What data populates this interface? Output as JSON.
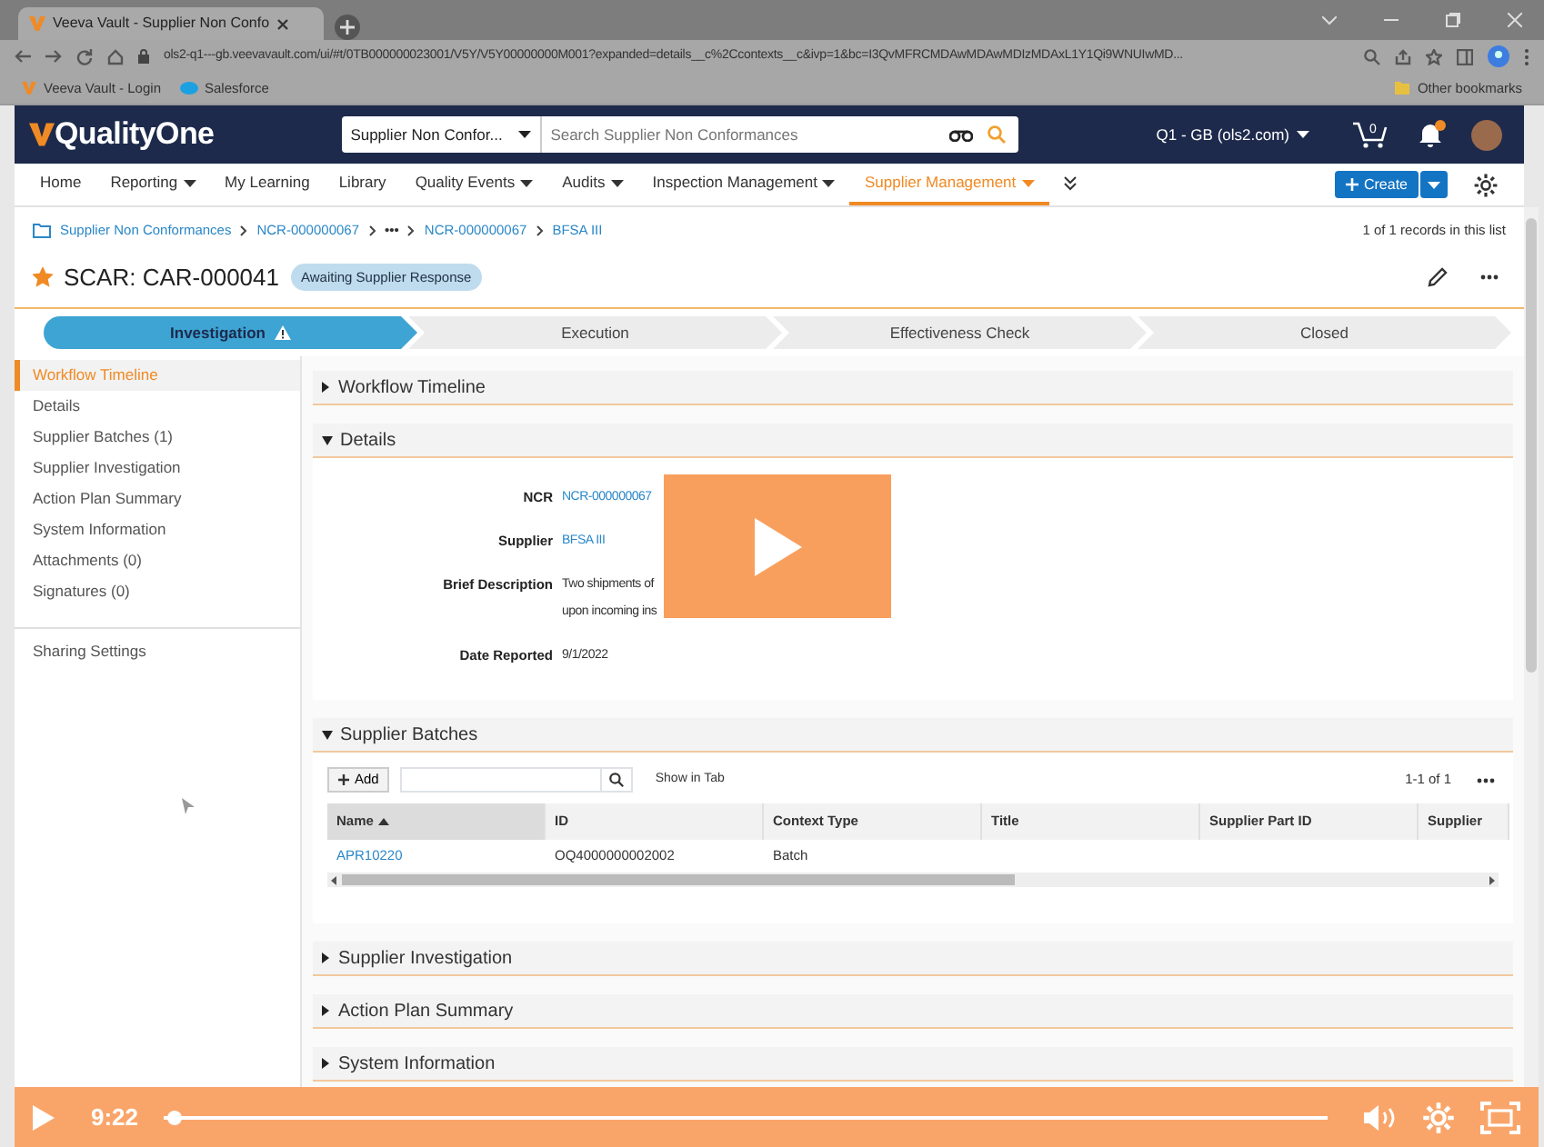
{
  "browser": {
    "tabs": [
      {
        "title": "Veeva Vault - Supplier Non Confo",
        "selected": true
      }
    ],
    "url": "ols2-q1---gb.veevavault.com/ui/#t/0TB000000023001/V5Y/V5Y00000000M001?expanded=details__c%2Ccontexts__c&ivp=1&bc=I3QvMFRCMDAwMDAwMDIzMDAxL1Y1Qi9WNUIwMD...",
    "bookmarks": [
      "Veeva Vault - Login",
      "Salesforce"
    ],
    "other_bookmarks": "Other bookmarks"
  },
  "app": {
    "logo": "QualityOne",
    "search_scope": "Supplier Non Confor...",
    "search_placeholder": "Search Supplier Non Conformances",
    "vault": "Q1 - GB (ols2.com)",
    "cart_count": "0",
    "has_notifications": true
  },
  "nav": [
    {
      "label": "Home",
      "dropdown": false,
      "selected": false
    },
    {
      "label": "Reporting",
      "dropdown": true,
      "selected": false
    },
    {
      "label": "My Learning",
      "dropdown": false,
      "selected": false
    },
    {
      "label": "Library",
      "dropdown": false,
      "selected": false
    },
    {
      "label": "Quality Events",
      "dropdown": true,
      "selected": false
    },
    {
      "label": "Audits",
      "dropdown": true,
      "selected": false
    },
    {
      "label": "Inspection Management",
      "dropdown": true,
      "selected": false
    },
    {
      "label": "Supplier Management",
      "dropdown": true,
      "selected": true
    }
  ],
  "create_button": "Create",
  "breadcrumb": [
    "Supplier Non Conformances",
    "NCR-000000067",
    "•••",
    "NCR-000000067",
    "BFSA III"
  ],
  "records": "1 of 1 records in this list",
  "record": {
    "title": "SCAR: CAR-000041",
    "favorite": true,
    "status": "Awaiting Supplier Response"
  },
  "stages": [
    {
      "label": "Investigation",
      "selected": true,
      "warning": true
    },
    {
      "label": "Execution",
      "selected": false,
      "warning": false
    },
    {
      "label": "Effectiveness Check",
      "selected": false,
      "warning": false
    },
    {
      "label": "Closed",
      "selected": false,
      "warning": false
    }
  ],
  "sidebar": {
    "items": [
      {
        "label": "Workflow Timeline",
        "selected": true
      },
      {
        "label": "Details",
        "selected": false
      },
      {
        "label": "Supplier Batches (1)",
        "selected": false
      },
      {
        "label": "Supplier Investigation",
        "selected": false
      },
      {
        "label": "Action Plan Summary",
        "selected": false
      },
      {
        "label": "System Information",
        "selected": false
      },
      {
        "label": "Attachments (0)",
        "selected": false
      },
      {
        "label": "Signatures (0)",
        "selected": false
      }
    ],
    "footer": "Sharing Settings"
  },
  "sections": [
    {
      "title": "Workflow Timeline",
      "expanded": false
    },
    {
      "title": "Details",
      "expanded": true,
      "kind": "fields",
      "fields": [
        {
          "label": "NCR",
          "value": "NCR-000000067",
          "link": true
        },
        {
          "label": "Supplier",
          "value": "BFSA III",
          "link": true
        },
        {
          "label": "Brief Description",
          "lines": [
            "Two shipments of",
            "upon incoming ins"
          ],
          "link": false
        },
        {
          "label": "Date Reported",
          "value": "9/1/2022",
          "link": false
        }
      ]
    },
    {
      "title": "Supplier Batches",
      "expanded": true,
      "kind": "table",
      "add": "Add",
      "show_in_tab": "Show in Tab",
      "count": "1-1 of 1",
      "columns": [
        {
          "label": "Name",
          "sorted": true
        },
        {
          "label": "ID",
          "sorted": false
        },
        {
          "label": "Context Type",
          "sorted": false
        },
        {
          "label": "Title",
          "sorted": false
        },
        {
          "label": "Supplier Part ID",
          "sorted": false
        },
        {
          "label": "Supplier",
          "sorted": false
        }
      ],
      "rows": [
        [
          "APR10220",
          "OQ4000000002002",
          "Batch",
          "",
          "",
          ""
        ]
      ]
    },
    {
      "title": "Supplier Investigation",
      "expanded": false
    },
    {
      "title": "Action Plan Summary",
      "expanded": false
    },
    {
      "title": "System Information",
      "expanded": false
    }
  ],
  "video": {
    "playing": false,
    "time": "9:22",
    "level": 0.01
  }
}
